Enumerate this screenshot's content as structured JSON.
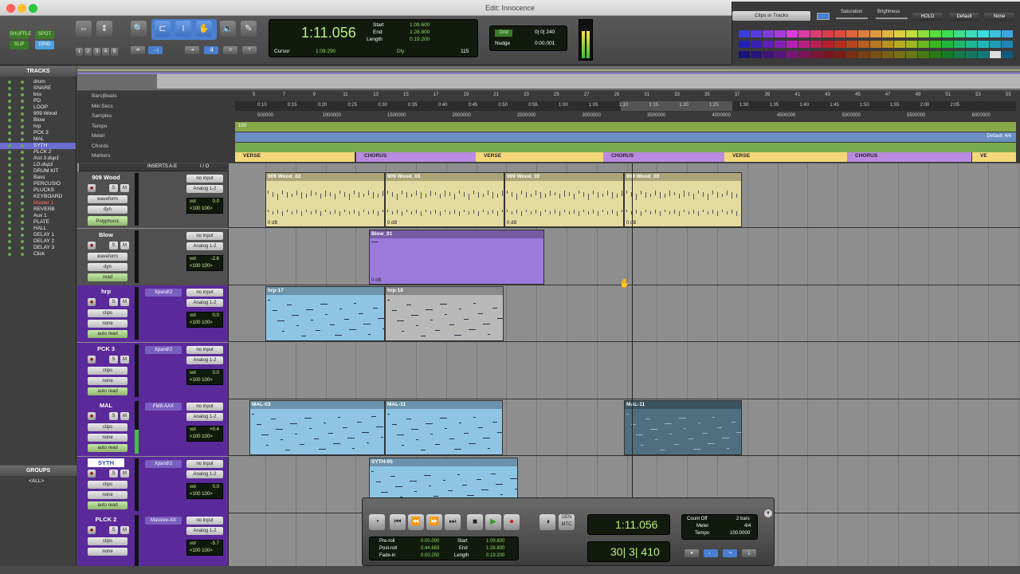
{
  "window": {
    "title": "Edit: Innocence"
  },
  "toolbar": {
    "modes": {
      "shuffle": "SHUFFLE",
      "spot": "SPOT",
      "slip": "SLIP",
      "grid": "GRID"
    },
    "zoom_presets": [
      "1",
      "2",
      "3",
      "4",
      "5"
    ],
    "counter": {
      "main": "1:11.056",
      "start_label": "Start",
      "end_label": "End",
      "length_label": "Length",
      "start": "1:09.600",
      "end": "1:28.800",
      "length": "0:19.200",
      "cursor_label": "Cursor",
      "cursor": "1:09.290",
      "dly": "Dly",
      "tempo": "115"
    },
    "grid_label": "Grid",
    "grid_value": "0| 0| 240",
    "nudge_label": "Nudge",
    "nudge_value": "0:00.001"
  },
  "color_palette": {
    "target": "Clips in Tracks",
    "saturation_label": "Saturation",
    "brightness_label": "Brightness",
    "hold": "HOLD",
    "default": "Default",
    "none": "None"
  },
  "tracks_panel": {
    "title": "TRACKS",
    "items": [
      "drum",
      "SNARE",
      "bss",
      "PD",
      "LOOP",
      "909 Wood",
      "Blow",
      "hrp",
      "PCK 3",
      "MAL",
      "SYTH",
      "PLCK 2",
      "Inst 3.dup1",
      "LD.dup1",
      "DRUM KIT",
      "Bass",
      "PERCUSIO",
      "PLUCKS",
      "KEYBOARD",
      "Master 1",
      "REVERB",
      "Aux 1",
      "PLATE",
      "HALL",
      "DELAY 1",
      "DELAY 2",
      "DELAY 3",
      "Click"
    ]
  },
  "groups_panel": {
    "title": "GROUPS",
    "all": "<ALL>"
  },
  "rulers": {
    "labels": [
      "Bars|Beats",
      "Min:Secs",
      "Samples",
      "Tempo",
      "Meter",
      "Chords",
      "Markers"
    ],
    "bars": [
      "5",
      "7",
      "9",
      "11",
      "13",
      "15",
      "17",
      "19",
      "21",
      "23",
      "25",
      "27",
      "29",
      "31",
      "33",
      "35",
      "37",
      "39",
      "41",
      "43",
      "45",
      "47",
      "49",
      "51",
      "53",
      "55"
    ],
    "minsecs": [
      "0:10",
      "0:15",
      "0:20",
      "0:25",
      "0:30",
      "0:35",
      "0:40",
      "0:45",
      "0:50",
      "0:55",
      "1:00",
      "1:05",
      "1:10",
      "1:15",
      "1:20",
      "1:25",
      "1:30",
      "1:35",
      "1:40",
      "1:45",
      "1:50",
      "1:55",
      "2:00",
      "2:05"
    ],
    "samples": [
      "500000",
      "1000000",
      "1500000",
      "2000000",
      "2500000",
      "3000000",
      "3500000",
      "4000000",
      "4500000",
      "5000000",
      "5500000",
      "6000000"
    ],
    "tempo_value": "100",
    "meter_value": "Default: 4/4",
    "markers": [
      "VERSE",
      "CHORUS",
      "VERSE",
      "CHORUS",
      "VERSE",
      "CHORUS",
      "VE"
    ]
  },
  "edit_header": {
    "inserts": "INSERTS A-E",
    "io": "I / O"
  },
  "tracks": [
    {
      "name": "909 Wood",
      "insert": "",
      "input": "no input",
      "output": "Analog 1-2",
      "view": "waveform",
      "mode": "dyn",
      "auto": "read",
      "extra": "Polyphonic",
      "vol_label": "vol",
      "vol": "0.0",
      "pan": "<100  100>",
      "clips": [
        {
          "name": "909 Wood_02",
          "gain": "0 dB"
        },
        {
          "name": "909 Wood_03",
          "gain": "0 dB"
        },
        {
          "name": "909 Wood_02",
          "gain": "0 dB"
        },
        {
          "name": "909 Wood_03",
          "gain": "0 dB"
        }
      ]
    },
    {
      "name": "Blow",
      "insert": "",
      "input": "no input",
      "output": "Analog 1-2",
      "view": "waveform",
      "mode": "dyn",
      "auto": "read",
      "extra": "",
      "vol_label": "vol",
      "vol": "-2.6",
      "pan": "<100  100>",
      "clips": [
        {
          "name": "Blow_01",
          "gain": "0 dB"
        }
      ]
    },
    {
      "name": "hrp",
      "insert": "Xpand!2",
      "input": "no input",
      "output": "Analog 1-2",
      "view": "clips",
      "mode": "none",
      "auto": "auto read",
      "extra": "",
      "vol_label": "vol",
      "vol": "0.0",
      "pan": "<100  100>",
      "clips": [
        {
          "name": "hrp-17",
          "gain": ""
        },
        {
          "name": "hrp-18",
          "gain": ""
        }
      ]
    },
    {
      "name": "PCK 3",
      "insert": "Xpand!2",
      "input": "no input",
      "output": "Analog 1-2",
      "view": "clips",
      "mode": "none",
      "auto": "auto read",
      "extra": "",
      "vol_label": "vol",
      "vol": "0.0",
      "pan": "<100  100>",
      "clips": []
    },
    {
      "name": "MAL",
      "insert": "FM8-AAX",
      "input": "no input",
      "output": "Analog 1-2",
      "view": "clips",
      "mode": "none",
      "auto": "auto read",
      "extra": "",
      "vol_label": "vol",
      "vol": "+0.4",
      "pan": "<100  100>",
      "clips": [
        {
          "name": "MAL-03",
          "gain": ""
        },
        {
          "name": "MAL-11",
          "gain": ""
        },
        {
          "name": "MAL-11",
          "gain": ""
        }
      ]
    },
    {
      "name": "SYTH",
      "insert": "Xpand!2",
      "input": "no input",
      "output": "Analog 1-2",
      "view": "clips",
      "mode": "none",
      "auto": "auto read",
      "extra": "",
      "vol_label": "vol",
      "vol": "0.0",
      "pan": "<100  100>",
      "clips": [
        {
          "name": "SYTH-05",
          "gain": ""
        }
      ]
    },
    {
      "name": "PLCK 2",
      "insert": "Massive-AX",
      "input": "no input",
      "output": "Analog 1-2",
      "view": "clips",
      "mode": "none",
      "auto": "",
      "extra": "",
      "vol_label": "vol",
      "vol": "-5.7",
      "pan": "<100  100>",
      "clips": []
    }
  ],
  "transport": {
    "main_counter": "1:11.056",
    "sub_counter": "30| 3| 410",
    "gen": "GEN",
    "mtc": "MTC",
    "preroll_label": "Pre-roll",
    "postroll_label": "Post-roll",
    "fadein_label": "Fade-in",
    "preroll": "0:00.000",
    "postroll": "0:44.683",
    "fadein": "0:00.250",
    "start_label": "Start",
    "end_label": "End",
    "length_label": "Length",
    "start": "1:09.600",
    "end": "1:28.800",
    "length": "0:19.200",
    "countoff": "Count Off",
    "countoff_val": "2 bars",
    "meter_label": "Meter",
    "meter_val": "4/4",
    "tempo_label": "Tempo",
    "tempo_val": "100.0000"
  },
  "colors": {
    "verse_marker": "#f3d77a",
    "chorus_marker": "#b88be0",
    "wood_clip": "#e3dba0",
    "blow_clip": "#9b7ad9",
    "blue_clip": "#8fc5e4",
    "track_purple": "#5a2a9a"
  }
}
